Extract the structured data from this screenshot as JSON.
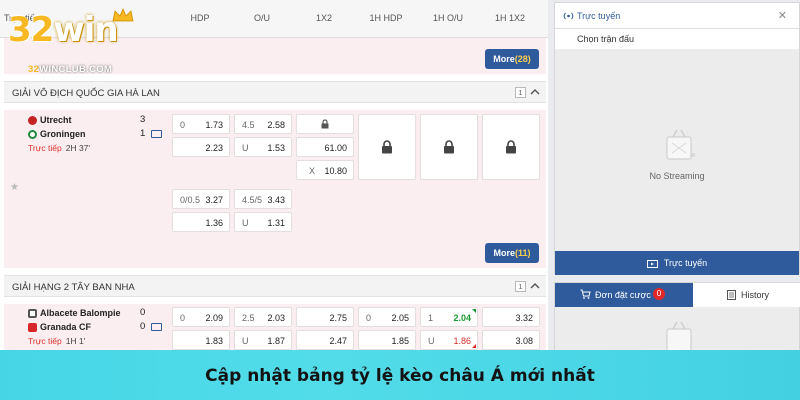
{
  "columns": {
    "first": "Trực tiếp",
    "hdp": "HDP",
    "ou": "O/U",
    "x12": "1X2",
    "h1hdp": "1H HDP",
    "h1ou": "1H O/U",
    "h1x12": "1H 1X2"
  },
  "logo": {
    "brand_a": "32",
    "brand_b": "win",
    "sub_a": "32",
    "sub_b": "WINCLUB.COM"
  },
  "top_more": {
    "label": "More",
    "count": "(28)"
  },
  "league1": {
    "name": "GIẢI VÔ ĐỊCH QUỐC GIA HÀ LAN",
    "count": "1",
    "home": "Utrecht",
    "home_score": "3",
    "away": "Groningen",
    "away_score": "1",
    "live": "Trực tiếp",
    "time": "2H 37'",
    "row1": {
      "hdp_line": "0",
      "hdp_home": "1.73",
      "hdp_away": "2.23",
      "ou_line": "4.5",
      "ou_over": "2.58",
      "ou_u": "U",
      "ou_under": "1.53",
      "x12_1": "61.00",
      "x12_x": "X",
      "x12_2": "10.80"
    },
    "row2": {
      "hdp_line": "0/0.5",
      "hdp_home": "3.27",
      "hdp_away": "1.36",
      "ou_line": "4.5/5",
      "ou_over": "3.43",
      "ou_u": "U",
      "ou_under": "1.31"
    },
    "more": {
      "label": "More",
      "count": "(11)"
    }
  },
  "league2": {
    "name": "GIẢI HẠNG 2 TÂY BAN NHA",
    "count": "1",
    "home": "Albacete Balompie",
    "home_score": "0",
    "away": "Granada CF",
    "away_score": "0",
    "live": "Trực tiếp",
    "time": "1H 1'",
    "row1": {
      "hdp_line": "0",
      "hdp_home": "2.09",
      "hdp_away": "1.83",
      "ou_line": "2.5",
      "ou_over": "2.03",
      "ou_u": "U",
      "ou_under": "1.87",
      "x12_1": "2.75",
      "x12_2": "2.47",
      "h1hdp_line": "0",
      "h1hdp_home": "2.05",
      "h1hdp_away": "1.85",
      "h1ou_line": "1",
      "h1ou_over": "2.04",
      "h1ou_u": "U",
      "h1ou_under": "1.86",
      "h1x12_1": "3.32",
      "h1x12_2": "3.08"
    }
  },
  "stream": {
    "title": "Trực tuyến",
    "select": "Chọn trận đấu",
    "no_stream": "No Streaming",
    "live_button": "Trực tuyến"
  },
  "bets": {
    "tab_slip": "Đơn đặt cược",
    "badge": "0",
    "tab_history": "History"
  },
  "banner": {
    "caption": "Cập nhật bảng tỷ lệ kèo châu Á mới nhất"
  },
  "colors": {
    "accent": "#2f5b9d",
    "live": "#e03030",
    "up": "#1a9a30",
    "down": "#d52b2b",
    "banner": "#45d6e6"
  }
}
